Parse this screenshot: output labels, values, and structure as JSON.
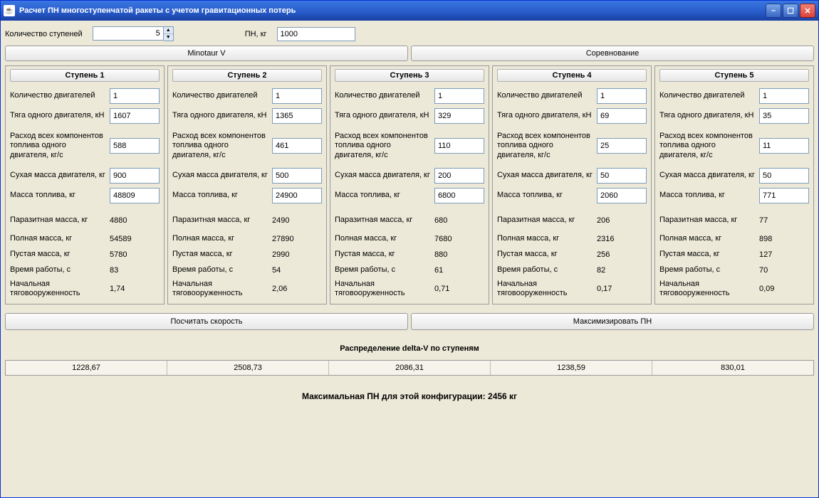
{
  "window": {
    "title": "Расчет ПН многоступенчатой ракеты с учетом гравитационных потерь"
  },
  "top": {
    "stages_label": "Количество ступеней",
    "stages_value": "5",
    "pn_label": "ПН, кг",
    "pn_value": "1000"
  },
  "presets": {
    "minotaur": "Minotaur V",
    "competition": "Соревнование"
  },
  "labels": {
    "stage_prefix": "Ступень",
    "engines": "Количество двигателей",
    "thrust": "Тяга одного двигателя, кН",
    "flowrate": "Расход всех компонентов топлива одного двигателя, кг/с",
    "drymass": "Сухая масса двигателя, кг",
    "fuelmass": "Масса топлива, кг",
    "parasitic": "Паразитная масса, кг",
    "fullmass": "Полная масса, кг",
    "emptymass": "Пустая масса, кг",
    "burntime": "Время работы, с",
    "twr": "Начальная тяговооруженность"
  },
  "stages": [
    {
      "title": "Ступень 1",
      "engines": "1",
      "thrust": "1607",
      "flowrate": "588",
      "drymass": "900",
      "fuelmass": "48809",
      "parasitic": "4880",
      "fullmass": "54589",
      "emptymass": "5780",
      "burntime": "83",
      "twr": "1,74"
    },
    {
      "title": "Ступень 2",
      "engines": "1",
      "thrust": "1365",
      "flowrate": "461",
      "drymass": "500",
      "fuelmass": "24900",
      "parasitic": "2490",
      "fullmass": "27890",
      "emptymass": "2990",
      "burntime": "54",
      "twr": "2,06"
    },
    {
      "title": "Ступень 3",
      "engines": "1",
      "thrust": "329",
      "flowrate": "110",
      "drymass": "200",
      "fuelmass": "6800",
      "parasitic": "680",
      "fullmass": "7680",
      "emptymass": "880",
      "burntime": "61",
      "twr": "0,71"
    },
    {
      "title": "Ступень 4",
      "engines": "1",
      "thrust": "69",
      "flowrate": "25",
      "drymass": "50",
      "fuelmass": "2060",
      "parasitic": "206",
      "fullmass": "2316",
      "emptymass": "256",
      "burntime": "82",
      "twr": "0,17"
    },
    {
      "title": "Ступень 5",
      "engines": "1",
      "thrust": "35",
      "flowrate": "11",
      "drymass": "50",
      "fuelmass": "771",
      "parasitic": "77",
      "fullmass": "898",
      "emptymass": "127",
      "burntime": "70",
      "twr": "0,09"
    }
  ],
  "buttons": {
    "calc": "Посчитать скорость",
    "maximize": "Максимизировать ПН"
  },
  "delta": {
    "title": "Распределение delta-V по ступеням",
    "values": [
      "1228,67",
      "2508,73",
      "2086,31",
      "1238,59",
      "830,01"
    ]
  },
  "result": {
    "text": "Максимальная ПН для этой конфигурации: 2456 кг"
  }
}
